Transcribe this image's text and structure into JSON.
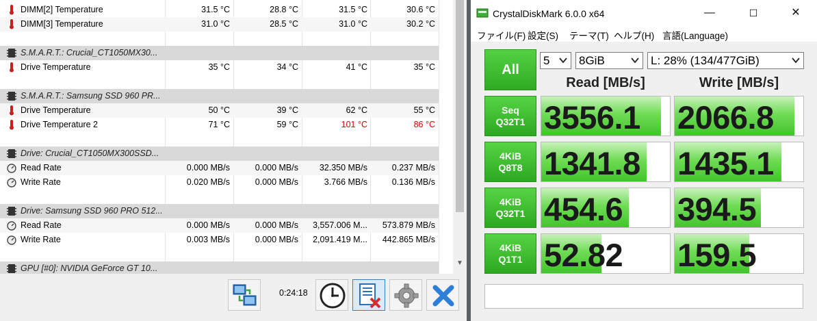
{
  "hwinfo": {
    "rows": [
      {
        "type": "sensor",
        "icon": "thermometer-icon",
        "name": "DIMM[2] Temperature",
        "c": [
          "31.5 °C",
          "28.8 °C",
          "31.5 °C",
          "30.6 °C"
        ],
        "red": [
          false,
          false,
          false,
          false
        ]
      },
      {
        "type": "sensor",
        "icon": "thermometer-icon",
        "name": "DIMM[3] Temperature",
        "c": [
          "31.0 °C",
          "28.5 °C",
          "31.0 °C",
          "30.2 °C"
        ],
        "red": [
          false,
          false,
          false,
          false
        ]
      },
      {
        "type": "blank"
      },
      {
        "type": "header",
        "icon": "chip-icon",
        "name": "S.M.A.R.T.: Crucial_CT1050MX30..."
      },
      {
        "type": "sensor",
        "icon": "thermometer-icon",
        "name": "Drive Temperature",
        "c": [
          "35 °C",
          "34 °C",
          "41 °C",
          "35 °C"
        ],
        "red": [
          false,
          false,
          false,
          false
        ]
      },
      {
        "type": "blank"
      },
      {
        "type": "header",
        "icon": "chip-icon",
        "name": "S.M.A.R.T.: Samsung SSD 960 PR..."
      },
      {
        "type": "sensor",
        "icon": "thermometer-icon",
        "name": "Drive Temperature",
        "c": [
          "50 °C",
          "39 °C",
          "62 °C",
          "55 °C"
        ],
        "red": [
          false,
          false,
          false,
          false
        ]
      },
      {
        "type": "sensor",
        "icon": "thermometer-icon",
        "name": "Drive Temperature 2",
        "c": [
          "71 °C",
          "59 °C",
          "101 °C",
          "86 °C"
        ],
        "red": [
          false,
          false,
          true,
          true
        ]
      },
      {
        "type": "blank"
      },
      {
        "type": "header",
        "icon": "chip-icon",
        "name": "Drive: Crucial_CT1050MX300SSD..."
      },
      {
        "type": "sensor",
        "icon": "gauge-icon",
        "name": "Read Rate",
        "c": [
          "0.000 MB/s",
          "0.000 MB/s",
          "32.350 MB/s",
          "0.237 MB/s"
        ],
        "red": [
          false,
          false,
          false,
          false
        ]
      },
      {
        "type": "sensor",
        "icon": "gauge-icon",
        "name": "Write Rate",
        "c": [
          "0.020 MB/s",
          "0.000 MB/s",
          "3.766 MB/s",
          "0.136 MB/s"
        ],
        "red": [
          false,
          false,
          false,
          false
        ]
      },
      {
        "type": "blank"
      },
      {
        "type": "header",
        "icon": "chip-icon",
        "name": "Drive: Samsung SSD 960 PRO 512..."
      },
      {
        "type": "sensor",
        "icon": "gauge-icon",
        "name": "Read Rate",
        "c": [
          "0.000 MB/s",
          "0.000 MB/s",
          "3,557.006 M...",
          "573.879 MB/s"
        ],
        "red": [
          false,
          false,
          false,
          false
        ]
      },
      {
        "type": "sensor",
        "icon": "gauge-icon",
        "name": "Write Rate",
        "c": [
          "0.003 MB/s",
          "0.000 MB/s",
          "2,091.419 M...",
          "442.865 MB/s"
        ],
        "red": [
          false,
          false,
          false,
          false
        ]
      },
      {
        "type": "blank"
      },
      {
        "type": "header",
        "icon": "chip-icon",
        "name": "GPU [#0]: NVIDIA GeForce GT 10..."
      }
    ],
    "timer": "0:24:18",
    "toolbar": [
      {
        "name": "network-icon",
        "active": false
      },
      {
        "name": "clock-icon",
        "active": false
      },
      {
        "name": "reset-log-icon",
        "active": true
      },
      {
        "name": "settings-gear-icon",
        "active": false
      },
      {
        "name": "close-x-icon",
        "active": false
      }
    ]
  },
  "cdm": {
    "title": "CrystalDiskMark 6.0.0 x64",
    "window_buttons": [
      "—",
      "☐",
      "✕"
    ],
    "menu": [
      "ファイル(F)",
      "設定(S)",
      "テーマ(T)",
      "ヘルプ(H)",
      "言語(Language)"
    ],
    "all_label": "All",
    "count": "5",
    "size": "8GiB",
    "drive": "L: 28% (134/477GiB)",
    "read_header": "Read [MB/s]",
    "write_header": "Write [MB/s]",
    "tests": [
      {
        "l1": "Seq",
        "l2": "Q32T1",
        "read": "3556.1",
        "write": "2066.8",
        "read_fill": 0.93,
        "write_fill": 0.93
      },
      {
        "l1": "4KiB",
        "l2": "Q8T8",
        "read": "1341.8",
        "write": "1435.1",
        "read_fill": 0.82,
        "write_fill": 0.83
      },
      {
        "l1": "4KiB",
        "l2": "Q32T1",
        "read": "454.6",
        "write": "394.5",
        "read_fill": 0.68,
        "write_fill": 0.67
      },
      {
        "l1": "4KiB",
        "l2": "Q1T1",
        "read": "52.82",
        "write": "159.5",
        "read_fill": 0.47,
        "write_fill": 0.58
      }
    ],
    "comment": ""
  },
  "colors": {
    "accent_green": "#2eab22",
    "alert_red": "#d00000"
  }
}
